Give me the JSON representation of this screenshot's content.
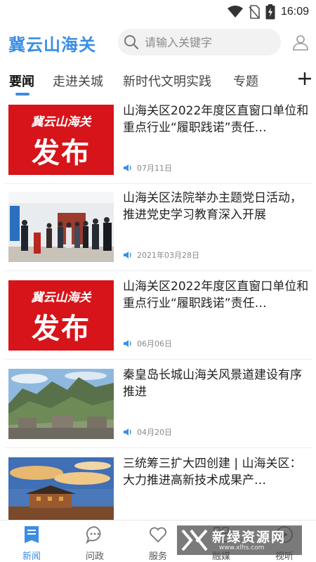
{
  "status_bar": {
    "time": "16:09"
  },
  "header": {
    "app_title": "冀云山海关",
    "search_placeholder": "请输入关键字"
  },
  "tabs": [
    {
      "label": "要闻"
    },
    {
      "label": "走进关城"
    },
    {
      "label": "新时代文明实践"
    },
    {
      "label": "专题"
    }
  ],
  "thumb_text": {
    "brand": "冀云山海关",
    "release": "发布"
  },
  "news": [
    {
      "title": "山海关区2022年度区直窗口单位和重点行业“履职践诺”责任…",
      "date": "07月11日",
      "thumb": "release"
    },
    {
      "title": "山海关区法院举办主题党日活动，推进党史学习教育深入开展",
      "date": "2021年03月28日",
      "thumb": "meeting-photo"
    },
    {
      "title": "山海关区2022年度区直窗口单位和重点行业“履职践诺”责任…",
      "date": "06月06日",
      "thumb": "release"
    },
    {
      "title": "秦皇岛长城山海关风景道建设有序推进",
      "date": "04月20日",
      "thumb": "great-wall-photo"
    },
    {
      "title": "三统筹三扩大四创建 | 山海关区：大力推进高新技术成果产…",
      "date": "",
      "thumb": "city-gate-photo"
    }
  ],
  "bottom_nav": [
    {
      "label": "新闻",
      "icon": "news-icon",
      "active": true
    },
    {
      "label": "问政",
      "icon": "chat-icon",
      "active": false
    },
    {
      "label": "服务",
      "icon": "heart-icon",
      "active": false
    },
    {
      "label": "融媒",
      "icon": "media-icon",
      "active": false
    },
    {
      "label": "视听",
      "icon": "play-icon",
      "active": false
    }
  ],
  "watermark": {
    "name": "新绿资源网",
    "url": "www.xlhs.com"
  },
  "colors": {
    "accent": "#3a8ee6",
    "release_red": "#d6141a"
  }
}
